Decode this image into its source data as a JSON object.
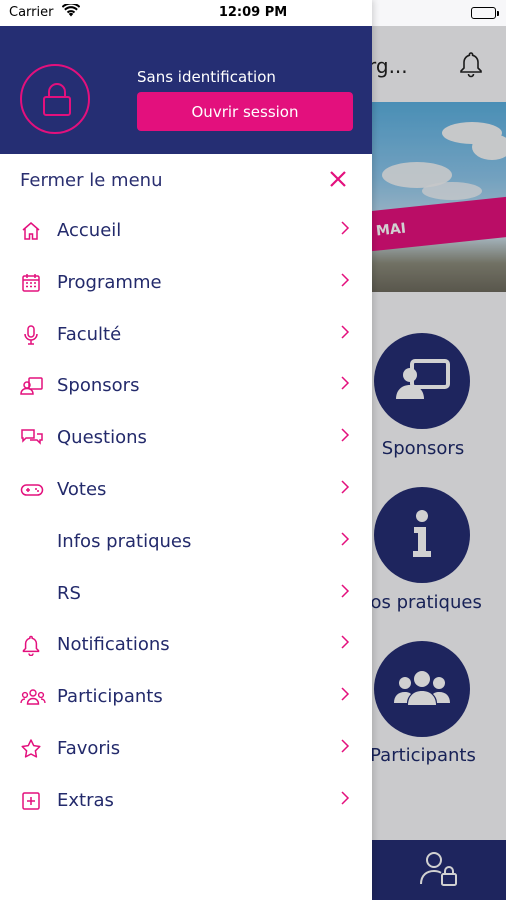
{
  "status_bar": {
    "carrier": "Carrier",
    "time": "12:09 PM"
  },
  "drawer": {
    "auth_status": "Sans identification",
    "login_button": "Ouvrir session",
    "close_menu": "Fermer le menu",
    "items": [
      {
        "label": "Accueil",
        "icon": "home-icon"
      },
      {
        "label": "Programme",
        "icon": "calendar-icon"
      },
      {
        "label": "Faculté",
        "icon": "microphone-icon"
      },
      {
        "label": "Sponsors",
        "icon": "presentation-icon"
      },
      {
        "label": "Questions",
        "icon": "chat-icon"
      },
      {
        "label": "Votes",
        "icon": "gamepad-icon"
      },
      {
        "label": "Infos pratiques",
        "icon": ""
      },
      {
        "label": "RS",
        "icon": ""
      },
      {
        "label": "Notifications",
        "icon": "bell-icon"
      },
      {
        "label": "Participants",
        "icon": "group-icon"
      },
      {
        "label": "Favoris",
        "icon": "star-icon"
      },
      {
        "label": "Extras",
        "icon": "plus-square-icon"
      }
    ]
  },
  "background": {
    "title_fragment": "rg...",
    "banner_text": "MAI",
    "tiles": [
      {
        "label": "Sponsors",
        "icon": "presentation-icon"
      },
      {
        "label": "fos pratiques",
        "icon": "info-icon"
      },
      {
        "label": "Participants",
        "icon": "group-icon"
      }
    ]
  },
  "colors": {
    "navy": "#252e73",
    "accent": "#e3107d"
  }
}
